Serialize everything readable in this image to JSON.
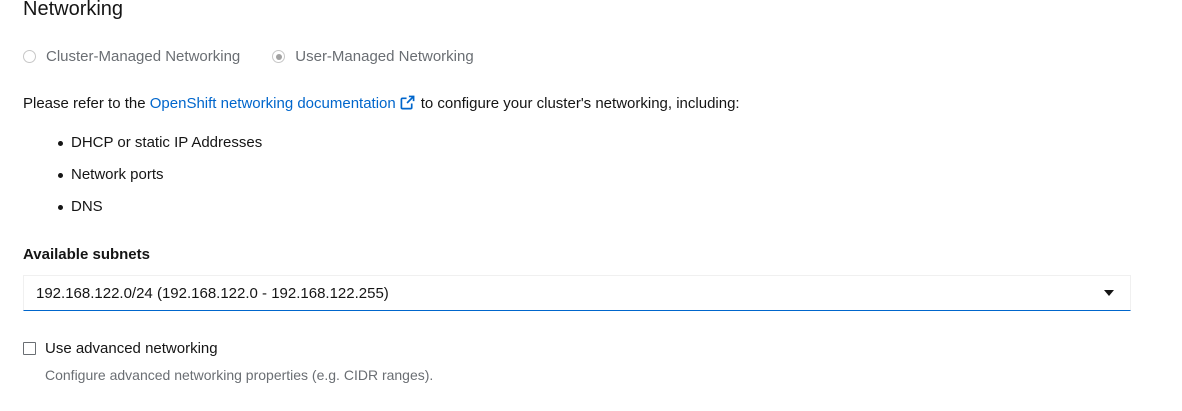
{
  "section": {
    "title": "Networking"
  },
  "networking_mode": {
    "options": [
      {
        "label": "Cluster-Managed Networking",
        "selected": false
      },
      {
        "label": "User-Managed Networking",
        "selected": true
      }
    ]
  },
  "intro": {
    "prefix": "Please refer to the ",
    "link_text": "OpenShift networking documentation",
    "suffix": "to configure your cluster's networking, including:",
    "link_icon": "external-link-icon"
  },
  "bullets": [
    "DHCP or static IP Addresses",
    "Network ports",
    "DNS"
  ],
  "subnets": {
    "label": "Available subnets",
    "selected": "192.168.122.0/24 (192.168.122.0 - 192.168.122.255)",
    "icon": "caret-down-icon"
  },
  "advanced": {
    "label": "Use advanced networking",
    "checked": false,
    "helper": "Configure advanced networking properties (e.g. CIDR ranges)."
  },
  "colors": {
    "link": "#0066cc",
    "text": "#151515",
    "muted": "#6a6e73"
  }
}
